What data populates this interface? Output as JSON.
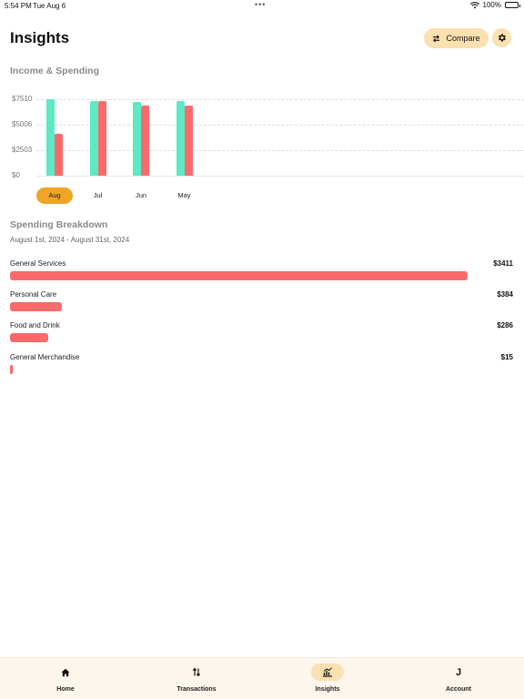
{
  "status_bar": {
    "time": "5:54 PM",
    "date": "Tue Aug 6",
    "battery": "100%"
  },
  "header": {
    "title": "Insights",
    "compare_label": "Compare"
  },
  "income_spending": {
    "title": "Income & Spending",
    "chart_data": {
      "type": "bar",
      "categories": [
        "Aug",
        "Jul",
        "Jun",
        "May"
      ],
      "series": [
        {
          "name": "",
          "color": "#5de8c6",
          "values": [
            7510,
            7300,
            7250,
            7300
          ]
        },
        {
          "name": "",
          "color": "#fb6a6a",
          "values": [
            4100,
            7300,
            6850,
            6900
          ]
        }
      ],
      "y_ticks": [
        "$0",
        "$2503",
        "$5006",
        "$7510"
      ],
      "ylim": [
        0,
        7510
      ],
      "selected_category": "Aug",
      "grid": true
    }
  },
  "breakdown": {
    "title": "Spending Breakdown",
    "date_range": "August 1st, 2024 - August 31st, 2024",
    "items": [
      {
        "name": "General Services",
        "amount": "$3411",
        "fraction": 1.0
      },
      {
        "name": "Personal Care",
        "amount": "$384",
        "fraction": 0.113
      },
      {
        "name": "Food and Drink",
        "amount": "$286",
        "fraction": 0.084
      },
      {
        "name": "General Merchandise",
        "amount": "$15",
        "fraction": 0.004
      }
    ]
  },
  "tabs": [
    {
      "label": "Home",
      "icon": "home-icon"
    },
    {
      "label": "Transactions",
      "icon": "transfer-arrows-icon"
    },
    {
      "label": "Insights",
      "icon": "insights-icon",
      "active": true
    },
    {
      "label": "Account",
      "icon": "avatar-initial",
      "initial": "J"
    }
  ]
}
